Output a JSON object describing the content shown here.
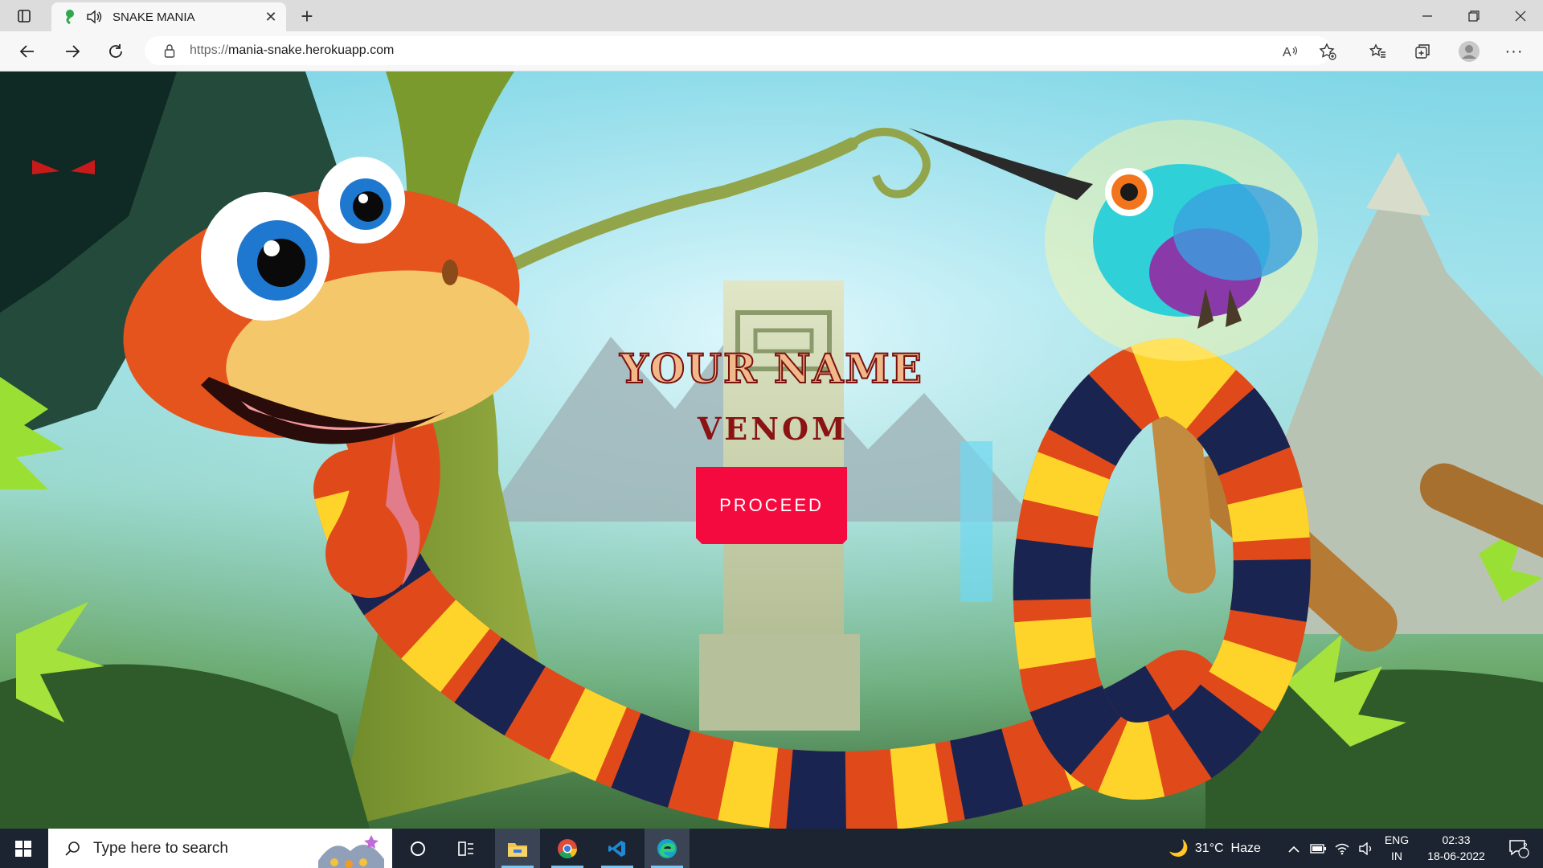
{
  "browser": {
    "tab_title": "SNAKE MANIA",
    "url_scheme": "https://",
    "url_host": "mania-snake.herokuapp.com",
    "icons": [
      "tab-actions-icon",
      "snake-favicon",
      "speaker-icon",
      "close-icon",
      "new-tab-icon",
      "minimize-icon",
      "restore-icon",
      "window-close-icon",
      "back-icon",
      "forward-icon",
      "refresh-icon",
      "lock-icon",
      "read-aloud-icon",
      "add-favorite-icon",
      "favorites-icon",
      "collections-icon",
      "profile-icon",
      "more-icon"
    ]
  },
  "game": {
    "heading": "YOUR NAME",
    "name_value": "VENOM",
    "proceed_label": "PROCEED"
  },
  "taskbar": {
    "search_placeholder": "Type here to search",
    "weather": "31°C  Haze",
    "lang_top": "ENG",
    "lang_bottom": "IN",
    "time": "02:33",
    "date": "18-06-2022",
    "notification_count": "2"
  }
}
